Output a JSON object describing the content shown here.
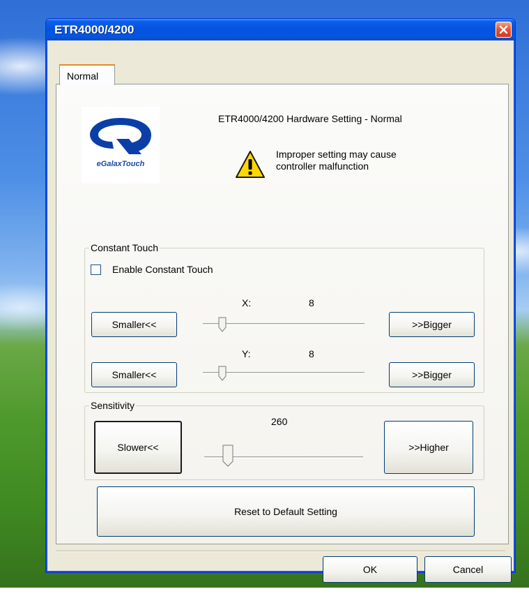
{
  "window": {
    "title": "ETR4000/4200",
    "close_icon": "close-icon"
  },
  "tabs": [
    {
      "label": "Normal",
      "active": true
    }
  ],
  "header": {
    "logo_text": "eGalaxTouch",
    "hardware_title": "ETR4000/4200 Hardware Setting - Normal",
    "warning_icon": "warning-icon",
    "warning_line1": "Improper setting may cause",
    "warning_line2": "controller malfunction"
  },
  "constant_touch": {
    "group_label": "Constant Touch",
    "checkbox_label": "Enable Constant Touch",
    "checked": false,
    "x": {
      "label": "X:",
      "value": "8",
      "smaller_label": "Smaller<<",
      "bigger_label": ">>Bigger",
      "slider_fraction": 0.12
    },
    "y": {
      "label": "Y:",
      "value": "8",
      "smaller_label": "Smaller<<",
      "bigger_label": ">>Bigger",
      "slider_fraction": 0.12
    }
  },
  "sensitivity": {
    "group_label": "Sensitivity",
    "value": "260",
    "slower_label": "Slower<<",
    "higher_label": ">>Higher",
    "slider_fraction": 0.15
  },
  "reset_label": "Reset to Default Setting",
  "footer": {
    "ok_label": "OK",
    "cancel_label": "Cancel"
  },
  "colors": {
    "titlebar": "#0553e0",
    "dialog_bg": "#ece9d8",
    "tab_accent": "#e68b2c",
    "warning_yellow": "#ffd800"
  }
}
